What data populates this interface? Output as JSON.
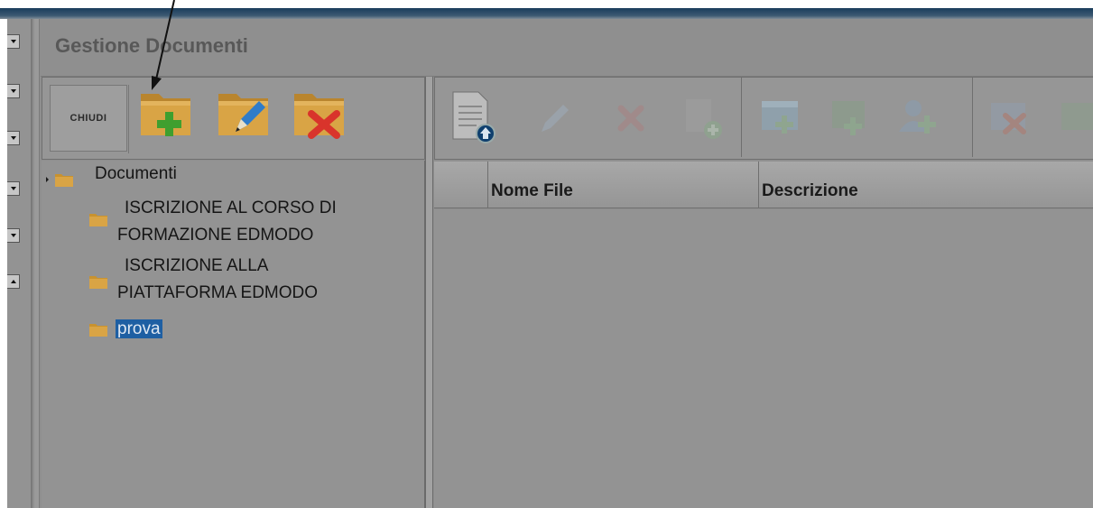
{
  "window": {
    "title": "Gestione Documenti"
  },
  "left_toolbar": {
    "close_label": "CHIUDI",
    "buttons": [
      {
        "name": "new-folder",
        "icon": "folder-plus-icon"
      },
      {
        "name": "edit-folder",
        "icon": "folder-pencil-icon"
      },
      {
        "name": "delete-folder",
        "icon": "folder-x-icon"
      }
    ]
  },
  "tree": {
    "root": "Documenti",
    "items": [
      {
        "label_line1": "ISCRIZIONE AL CORSO DI",
        "label_line2": "FORMAZIONE EDMODO"
      },
      {
        "label_line1": "ISCRIZIONE ALLA",
        "label_line2": "PIATTAFORMA EDMODO"
      },
      {
        "label_line1": "prova",
        "selected": true
      }
    ]
  },
  "right_toolbar": {
    "groups": [
      [
        "upload-document-icon",
        "edit-icon",
        "delete-icon",
        "add-icon"
      ],
      [
        "add-permission-icon",
        "share-icon",
        "add-user-icon"
      ],
      [
        "remove-icon",
        "export-icon"
      ]
    ]
  },
  "grid": {
    "columns": [
      "Nome File",
      "Descrizione"
    ]
  },
  "colors": {
    "overlay_gray": "#8f8f8f",
    "selection_blue": "#1e5fa3",
    "folder_orange": "#d9a445",
    "plus_green": "#3f9f2f",
    "delete_red": "#d9342b",
    "pencil_blue": "#2f7cc9"
  }
}
